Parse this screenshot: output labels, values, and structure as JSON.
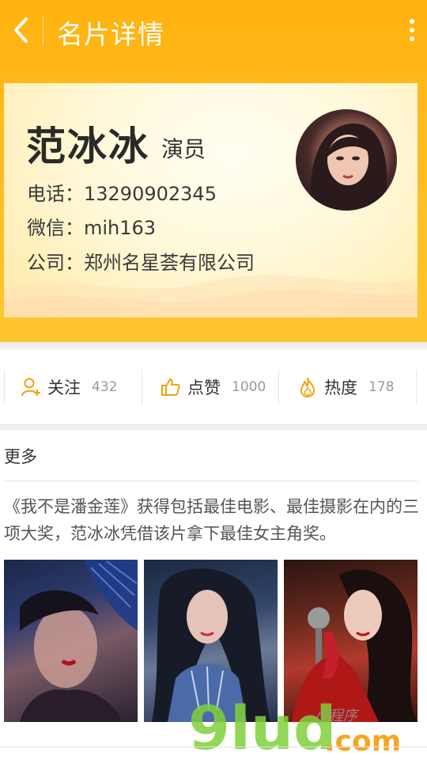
{
  "colors": {
    "header_bg": "#ffb30f",
    "card_bg": "#fff8d9",
    "accent_icon": "#f3a20f"
  },
  "nav": {
    "title": "名片详情",
    "back_icon": "chevron-left-icon",
    "more_icon": "vertical-dots-icon"
  },
  "card": {
    "name": "范冰冰",
    "role": "演员",
    "phone_line": "电话：13290902345",
    "wechat_line": "微信：mih163",
    "company_line": "公司：郑州名星荟有限公司"
  },
  "stats": [
    {
      "label": "关注",
      "count": "432",
      "icon": "user-plus-icon"
    },
    {
      "label": "点赞",
      "count": "1000",
      "icon": "thumbs-up-icon"
    },
    {
      "label": "热度",
      "count": "178",
      "icon": "flame-icon"
    }
  ],
  "more": {
    "title": "更多",
    "description": "《我不是潘金莲》获得包括最佳电影、最佳摄影在内的三项大奖，范冰冰凭借该片拿下最佳女主角奖。"
  },
  "watermark": {
    "text": "9ludcom",
    "signature": "小程序"
  }
}
